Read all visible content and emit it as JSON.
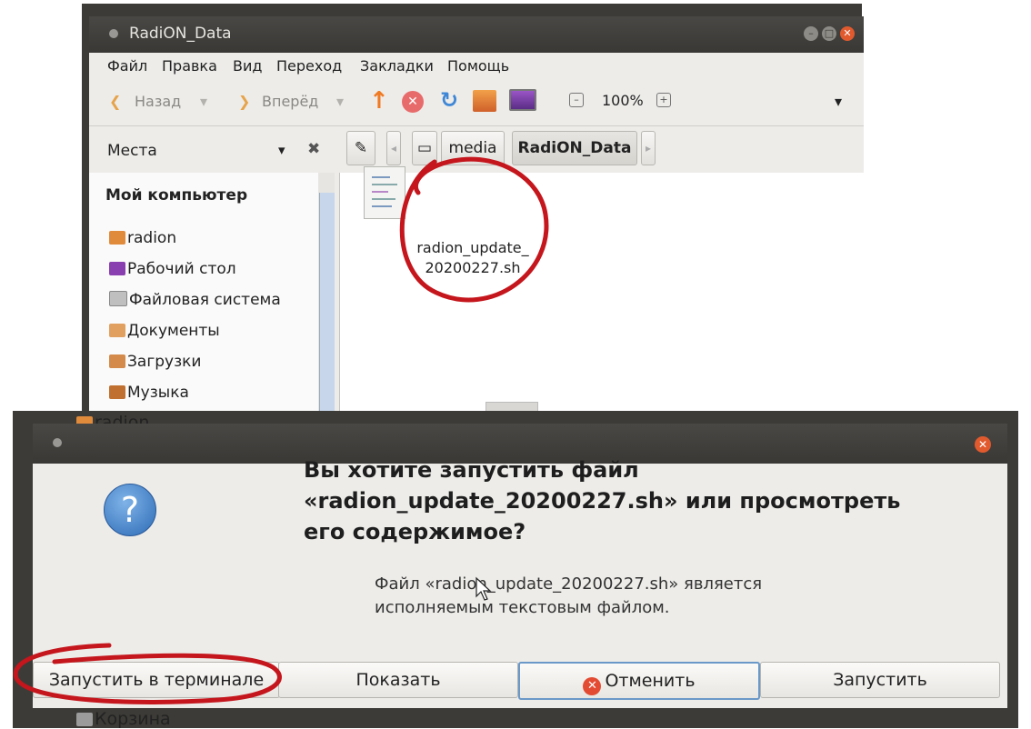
{
  "file_manager": {
    "window_title": "RadiON_Data",
    "menu": [
      "Файл",
      "Правка",
      "Вид",
      "Переход",
      "Закладки",
      "Помощь"
    ],
    "toolbar": {
      "back": "Назад",
      "forward": "Вперёд",
      "zoom": "100%"
    },
    "places_label": "Места",
    "path_segments": [
      "media",
      "RadiON_Data"
    ],
    "sidebar": {
      "section": "Мой компьютер",
      "items": [
        "radion",
        "Рабочий стол",
        "Файловая система",
        "Документы",
        "Загрузки",
        "Музыка"
      ],
      "behind_items": [
        "radion",
        "Корзина"
      ]
    },
    "file": {
      "name_line1": "radion_update_",
      "name_line2": "20200227.sh"
    }
  },
  "dialog": {
    "headline_line1": "Вы хотите запустить файл",
    "headline_line2": "«radion_update_20200227.sh» или просмотреть",
    "headline_line3": "его содержимое?",
    "sub_line1": "Файл «radion_update_20200227.sh» является",
    "sub_line2": "исполняемым текстовым файлом.",
    "buttons": {
      "run_in_terminal": "Запустить в терминале",
      "show": "Показать",
      "cancel": "Отменить",
      "run": "Запустить"
    }
  },
  "colors": {
    "annotation": "#c4161c",
    "accent": "#e15a2e",
    "title_bar": "#3d3b37"
  }
}
